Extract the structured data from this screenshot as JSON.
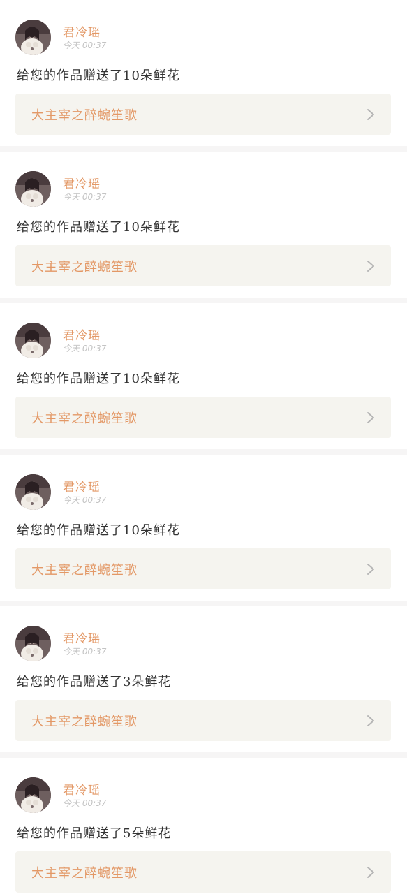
{
  "colors": {
    "accent": "#e39866",
    "text": "#333333",
    "muted": "#c3c3c3",
    "work_bg": "#f5f4ef",
    "separator": "#f6f5f5"
  },
  "notifications": [
    {
      "user": "君冷瑶",
      "time": "今天 00:37",
      "message": "给您的作品赠送了10朵鲜花",
      "work_title": "大主宰之醉蜿笙歌",
      "avatar_icon": "user-avatar",
      "chevron_icon": "chevron-right-icon"
    },
    {
      "user": "君冷瑶",
      "time": "今天 00:37",
      "message": "给您的作品赠送了10朵鲜花",
      "work_title": "大主宰之醉蜿笙歌",
      "avatar_icon": "user-avatar",
      "chevron_icon": "chevron-right-icon"
    },
    {
      "user": "君冷瑶",
      "time": "今天 00:37",
      "message": "给您的作品赠送了10朵鲜花",
      "work_title": "大主宰之醉蜿笙歌",
      "avatar_icon": "user-avatar",
      "chevron_icon": "chevron-right-icon"
    },
    {
      "user": "君冷瑶",
      "time": "今天 00:37",
      "message": "给您的作品赠送了10朵鲜花",
      "work_title": "大主宰之醉蜿笙歌",
      "avatar_icon": "user-avatar",
      "chevron_icon": "chevron-right-icon"
    },
    {
      "user": "君冷瑶",
      "time": "今天 00:37",
      "message": "给您的作品赠送了3朵鲜花",
      "work_title": "大主宰之醉蜿笙歌",
      "avatar_icon": "user-avatar",
      "chevron_icon": "chevron-right-icon"
    },
    {
      "user": "君冷瑶",
      "time": "今天 00:37",
      "message": "给您的作品赠送了5朵鲜花",
      "work_title": "大主宰之醉蜿笙歌",
      "avatar_icon": "user-avatar",
      "chevron_icon": "chevron-right-icon"
    }
  ]
}
